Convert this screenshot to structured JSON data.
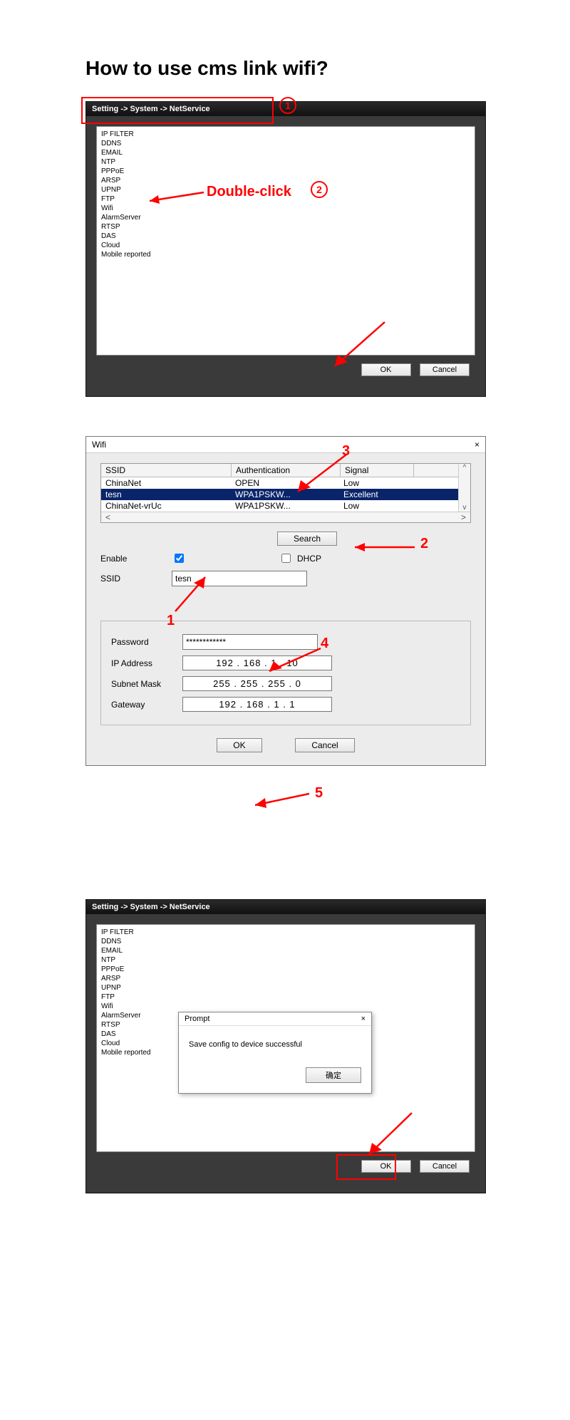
{
  "heading": "How to use cms link wifi?",
  "annotation": {
    "double_click": "Double-click",
    "circle1": "1",
    "circle2": "2",
    "num1": "1",
    "num2": "2",
    "num3": "3",
    "num4": "4",
    "num5": "5"
  },
  "window1": {
    "breadcrumb": "Setting -> System -> NetService",
    "list": [
      "IP FILTER",
      "DDNS",
      "EMAIL",
      "NTP",
      "PPPoE",
      "ARSP",
      "UPNP",
      "FTP",
      "Wifi",
      "AlarmServer",
      "RTSP",
      "DAS",
      "Cloud",
      "Mobile reported"
    ],
    "ok": "OK",
    "cancel": "Cancel"
  },
  "wifi": {
    "title": "Wifi",
    "close": "×",
    "cols": {
      "ssid": "SSID",
      "auth": "Authentication",
      "sig": "Signal"
    },
    "rows": [
      {
        "ssid": "ChinaNet",
        "auth": "OPEN",
        "sig": "Low",
        "selected": false
      },
      {
        "ssid": "tesn",
        "auth": "WPA1PSKW...",
        "sig": "Excellent",
        "selected": true
      },
      {
        "ssid": "ChinaNet-vrUc",
        "auth": "WPA1PSKW...",
        "sig": "Low",
        "selected": false
      }
    ],
    "scroll_left": "<",
    "scroll_right": ">",
    "scroll_up": "^",
    "scroll_down": "v",
    "search": "Search",
    "enable_label": "Enable",
    "enable_checked": true,
    "dhcp_label": "DHCP",
    "dhcp_checked": false,
    "ssid_label": "SSID",
    "ssid_value": "tesn",
    "password_label": "Password",
    "password_value": "************",
    "ip_label": "IP Address",
    "ip_value": "192 . 168 .   1  .  10",
    "mask_label": "Subnet Mask",
    "mask_value": "255 . 255 . 255 .   0",
    "gw_label": "Gateway",
    "gw_value": "192 . 168 .   1  .   1",
    "ok": "OK",
    "cancel": "Cancel"
  },
  "window3": {
    "breadcrumb": "Setting -> System -> NetService",
    "list": [
      "IP FILTER",
      "DDNS",
      "EMAIL",
      "NTP",
      "PPPoE",
      "ARSP",
      "UPNP",
      "FTP",
      "Wifi",
      "AlarmServer",
      "RTSP",
      "DAS",
      "Cloud",
      "Mobile reported"
    ],
    "prompt_title": "Prompt",
    "prompt_close": "×",
    "prompt_msg": "Save config to device successful",
    "prompt_ok": "确定",
    "ok": "OK",
    "cancel": "Cancel"
  }
}
